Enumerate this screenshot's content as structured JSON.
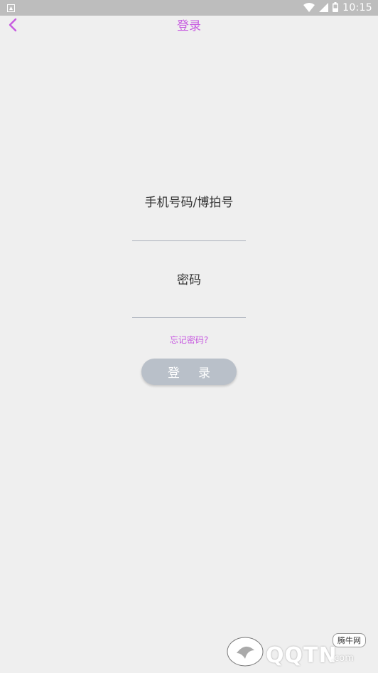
{
  "status_bar": {
    "time": "10:15",
    "icons": [
      "notification-icon",
      "wifi-icon",
      "signal-icon",
      "battery-icon"
    ]
  },
  "header": {
    "title": "登录",
    "back_icon": "chevron-left-icon"
  },
  "form": {
    "account_label": "手机号码/博拍号",
    "account_value": "",
    "password_label": "密码",
    "password_value": "",
    "forgot_link": "忘记密码?",
    "login_button": "登录"
  },
  "watermark": {
    "brand": "QQTN",
    "domain_suffix": ".com",
    "tag": "腾牛网"
  },
  "colors": {
    "accent": "#c75be0",
    "background": "#efefef",
    "status_bar": "#bdbdbd",
    "button": "#b9c0c9",
    "underline": "#aab0bb"
  }
}
